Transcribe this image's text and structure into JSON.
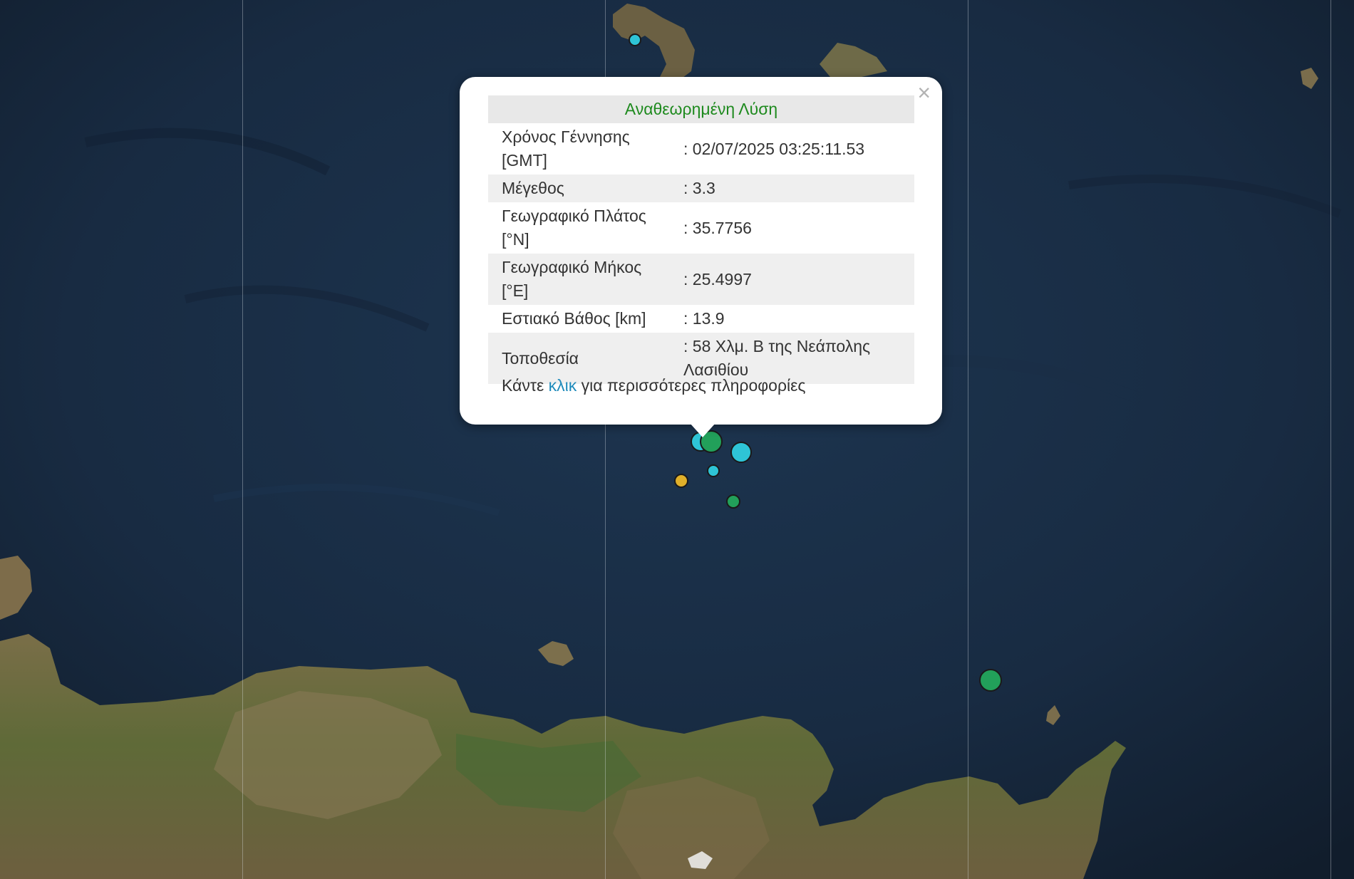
{
  "popup": {
    "title": "Αναθεωρημένη Λύση",
    "rows": [
      {
        "label": "Χρόνος Γέννησης [GMT]",
        "value": ": 02/07/2025 03:25:11.53"
      },
      {
        "label": "Μέγεθος",
        "value": ": 3.3"
      },
      {
        "label": "Γεωγραφικό Πλάτος [°N]",
        "value": ": 35.7756"
      },
      {
        "label": "Γεωγραφικό Μήκος [°E]",
        "value": ": 25.4997"
      },
      {
        "label": "Εστιακό Βάθος [km]",
        "value": ": 13.9"
      },
      {
        "label": "Τοποθεσία",
        "value": ": 58 Χλμ. Β της Νεάπολης Λασιθίου"
      }
    ],
    "more_prefix": "Κάντε",
    "more_link": "κλικ",
    "more_suffix": "για περισσότερες πληροφορίες",
    "close_icon": "×"
  },
  "markers": [
    {
      "color": "#2ec4d6"
    },
    {
      "color": "#2ec4d6"
    },
    {
      "color": "#22a05a"
    },
    {
      "color": "#2ec4d6"
    },
    {
      "color": "#2ec4d6"
    },
    {
      "color": "#e0b02a"
    },
    {
      "color": "#22a05a"
    },
    {
      "color": "#22a05a"
    }
  ],
  "colors": {
    "sea": "#16263a",
    "land": "#6b6540",
    "title_green": "#1e8a1e",
    "link_blue": "#1f8bbb"
  }
}
